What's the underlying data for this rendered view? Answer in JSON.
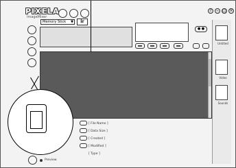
{
  "app": {
    "logo": "PIXELA",
    "logo_subtitle": "ImageMixer"
  },
  "camera": {
    "selected": "Memory Stick",
    "cam_button_label": "ir"
  },
  "right_panel": {
    "folders": [
      {
        "label": "Untitled"
      },
      {
        "label": "Video"
      },
      {
        "label": "Sounds"
      }
    ]
  },
  "info": {
    "fields": [
      "[ File Name ]",
      "[ Data Size ]",
      "[ Created ]",
      "[ Modified ]",
      "[ Type ]"
    ]
  },
  "bottom": {
    "preview_label": "Preview"
  },
  "colors": {
    "main_area": "#5a5a5a",
    "background": "#f3f3f3"
  }
}
